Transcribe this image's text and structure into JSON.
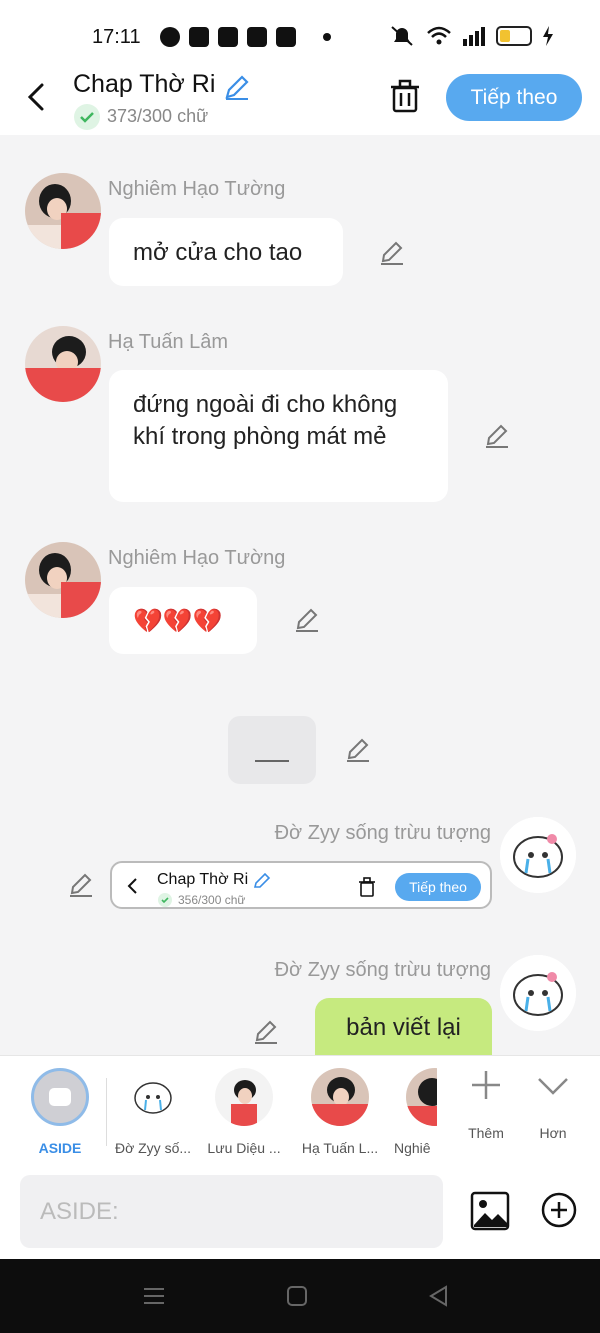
{
  "status_bar": {
    "time": "17:11"
  },
  "header": {
    "title": "Chap Thờ Ri",
    "word_count": "373/300 chữ",
    "next_label": "Tiếp theo"
  },
  "messages": [
    {
      "sender": "Nghiêm Hạo Tường",
      "text": "mở cửa cho tao"
    },
    {
      "sender": "Hạ Tuấn Lâm",
      "text": "đứng ngoài đi cho không khí trong phòng mát mẻ"
    },
    {
      "sender": "Nghiêm Hạo Tường",
      "text": "💔💔💔"
    },
    {
      "sender": "Đờ Zyy sống trừu tượng",
      "text": ""
    },
    {
      "sender": "Đờ Zyy sống trừu tượng",
      "text": "bản viết lại"
    }
  ],
  "divider_text": "___",
  "embedded_card": {
    "title": "Chap Thờ Ri",
    "word_count": "356/300 chữ",
    "next_label": "Tiếp theo"
  },
  "character_bar": {
    "aside_label": "ASIDE",
    "characters": [
      {
        "name": "Đờ Zyy số..."
      },
      {
        "name": "Lưu Diệu ..."
      },
      {
        "name": "Hạ Tuấn L..."
      },
      {
        "name": "Nghiê"
      }
    ],
    "more_label": "Thêm",
    "collapse_label": "Hơn"
  },
  "input": {
    "placeholder": "ASIDE:"
  },
  "colors": {
    "accent": "#58a9ef",
    "green_bubble": "#c6ea7f",
    "background": "#f4f4f5"
  }
}
